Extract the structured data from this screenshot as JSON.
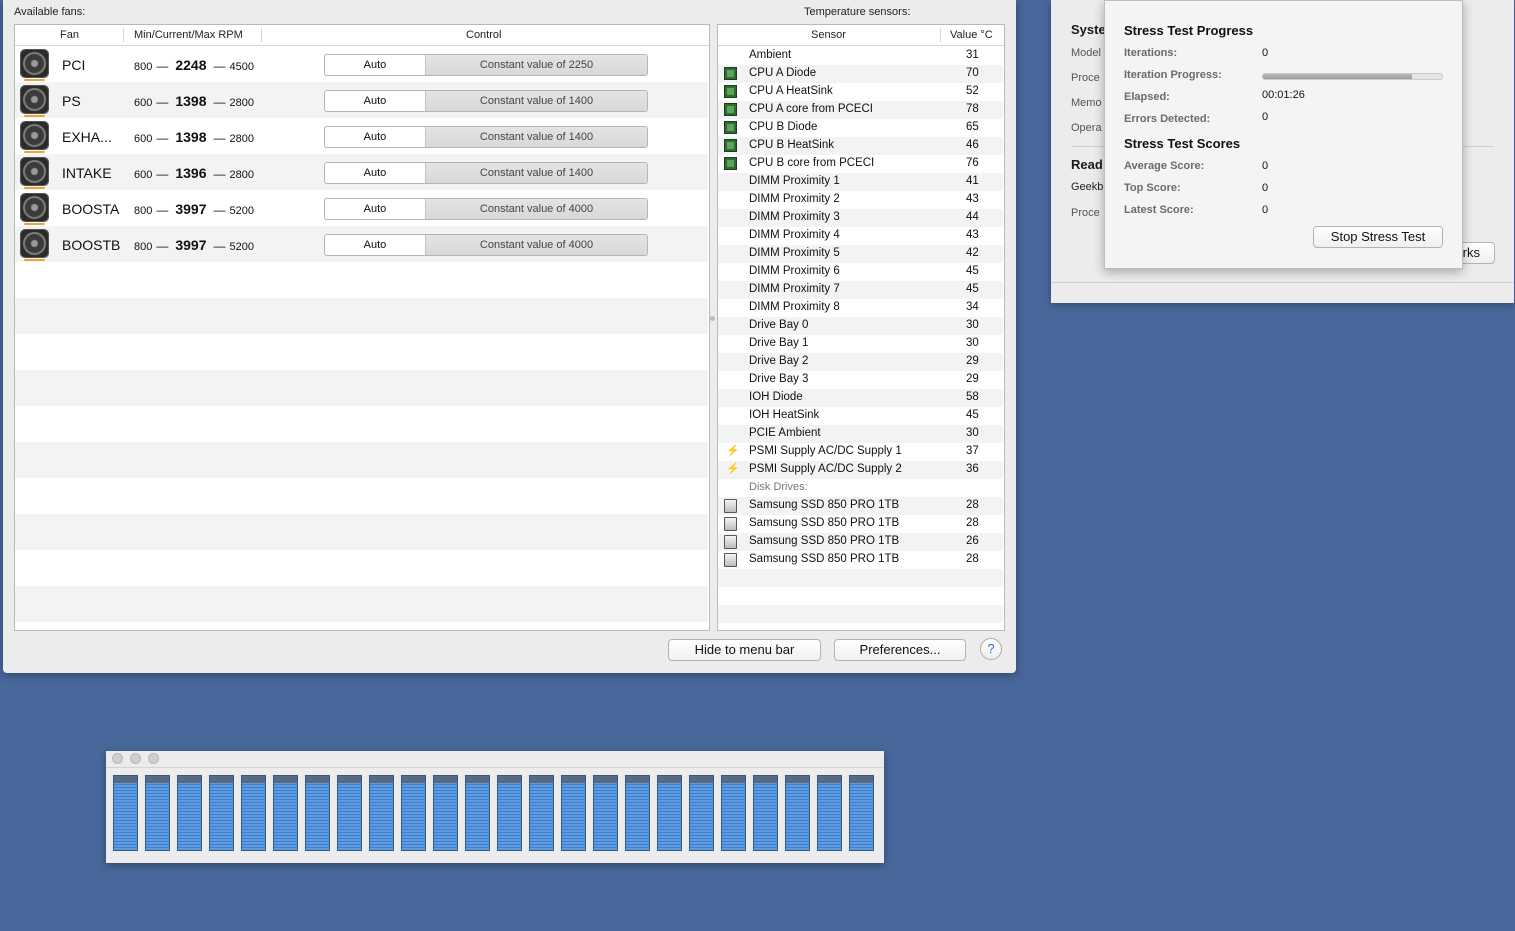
{
  "fan_window": {
    "available_fans_label": "Available fans:",
    "temperature_sensors_label": "Temperature sensors:",
    "fan_headers": {
      "fan": "Fan",
      "rpm": "Min/Current/Max RPM",
      "control": "Control"
    },
    "fans": [
      {
        "name": "PCI",
        "min": "800",
        "current": "2248",
        "max": "4500",
        "auto_label": "Auto",
        "control_value": "Constant value of 2250"
      },
      {
        "name": "PS",
        "min": "600",
        "current": "1398",
        "max": "2800",
        "auto_label": "Auto",
        "control_value": "Constant value of 1400"
      },
      {
        "name": "EXHA...",
        "min": "600",
        "current": "1398",
        "max": "2800",
        "auto_label": "Auto",
        "control_value": "Constant value of 1400"
      },
      {
        "name": "INTAKE",
        "min": "600",
        "current": "1396",
        "max": "2800",
        "auto_label": "Auto",
        "control_value": "Constant value of 1400"
      },
      {
        "name": "BOOSTA",
        "min": "800",
        "current": "3997",
        "max": "5200",
        "auto_label": "Auto",
        "control_value": "Constant value of 4000"
      },
      {
        "name": "BOOSTB",
        "min": "800",
        "current": "3997",
        "max": "5200",
        "auto_label": "Auto",
        "control_value": "Constant value of 4000"
      }
    ],
    "rpm_dash": "—",
    "sensor_headers": {
      "sensor": "Sensor",
      "value": "Value °C"
    },
    "sensors": [
      {
        "name": "Ambient",
        "value": "31",
        "icon": "none"
      },
      {
        "name": "CPU A Diode",
        "value": "70",
        "icon": "chip-icon"
      },
      {
        "name": "CPU A HeatSink",
        "value": "52",
        "icon": "chip-icon"
      },
      {
        "name": "CPU A core from PCECI",
        "value": "78",
        "icon": "chip-icon"
      },
      {
        "name": "CPU B Diode",
        "value": "65",
        "icon": "chip-icon"
      },
      {
        "name": "CPU B HeatSink",
        "value": "46",
        "icon": "chip-icon"
      },
      {
        "name": "CPU B core from PCECI",
        "value": "76",
        "icon": "chip-icon"
      },
      {
        "name": "DIMM Proximity 1",
        "value": "41",
        "icon": "none"
      },
      {
        "name": "DIMM Proximity 2",
        "value": "43",
        "icon": "none"
      },
      {
        "name": "DIMM Proximity 3",
        "value": "44",
        "icon": "none"
      },
      {
        "name": "DIMM Proximity 4",
        "value": "43",
        "icon": "none"
      },
      {
        "name": "DIMM Proximity 5",
        "value": "42",
        "icon": "none"
      },
      {
        "name": "DIMM Proximity 6",
        "value": "45",
        "icon": "none"
      },
      {
        "name": "DIMM Proximity 7",
        "value": "45",
        "icon": "none"
      },
      {
        "name": "DIMM Proximity 8",
        "value": "34",
        "icon": "none"
      },
      {
        "name": "Drive Bay 0",
        "value": "30",
        "icon": "none"
      },
      {
        "name": "Drive Bay 1",
        "value": "30",
        "icon": "none"
      },
      {
        "name": "Drive Bay 2",
        "value": "29",
        "icon": "none"
      },
      {
        "name": "Drive Bay 3",
        "value": "29",
        "icon": "none"
      },
      {
        "name": "IOH Diode",
        "value": "58",
        "icon": "none"
      },
      {
        "name": "IOH HeatSink",
        "value": "45",
        "icon": "none"
      },
      {
        "name": "PCIE Ambient",
        "value": "30",
        "icon": "none"
      },
      {
        "name": "PSMI Supply AC/DC Supply 1",
        "value": "37",
        "icon": "lightning-icon"
      },
      {
        "name": "PSMI Supply AC/DC Supply 2",
        "value": "36",
        "icon": "lightning-icon"
      }
    ],
    "disk_drives_label": "Disk Drives:",
    "disks": [
      {
        "name": "Samsung SSD 850 PRO 1TB",
        "value": "28",
        "icon": "disk-icon"
      },
      {
        "name": "Samsung SSD 850 PRO 1TB",
        "value": "28",
        "icon": "disk-icon"
      },
      {
        "name": "Samsung SSD 850 PRO 1TB",
        "value": "26",
        "icon": "disk-icon"
      },
      {
        "name": "Samsung SSD 850 PRO 1TB",
        "value": "28",
        "icon": "disk-icon"
      }
    ],
    "hide_button": "Hide to menu bar",
    "preferences_button": "Preferences...",
    "help_button": "?"
  },
  "geekbench_window": {
    "partial_labels": {
      "system": "Syste",
      "model": "Model",
      "processor": "Proce",
      "memory": "Memo",
      "os": "Opera",
      "ready": "Read",
      "geekbench": "Geekb",
      "process2": "Proce",
      "button_tail": "rks"
    }
  },
  "stress_popover": {
    "progress_title": "Stress Test Progress",
    "iterations_label": "Iterations:",
    "iterations_value": "0",
    "iteration_progress_label": "Iteration Progress:",
    "iteration_progress": 0.83,
    "elapsed_label": "Elapsed:",
    "elapsed_value": "00:01:26",
    "errors_label": "Errors Detected:",
    "errors_value": "0",
    "scores_title": "Stress Test Scores",
    "average_label": "Average Score:",
    "average_value": "0",
    "top_label": "Top Score:",
    "top_value": "0",
    "latest_label": "Latest Score:",
    "latest_value": "0",
    "stop_button": "Stop Stress Test"
  },
  "cpu_meter": {
    "core_count": 24,
    "core_loads": [
      1,
      1,
      1,
      1,
      1,
      1,
      1,
      1,
      1,
      1,
      1,
      1,
      1,
      1,
      1,
      1,
      1,
      1,
      1,
      1,
      1,
      1,
      1,
      1
    ]
  },
  "colors": {
    "desktop": "#48689c",
    "meter_bar": "#4a8ad6",
    "fan_accent": "#e8a53a"
  }
}
